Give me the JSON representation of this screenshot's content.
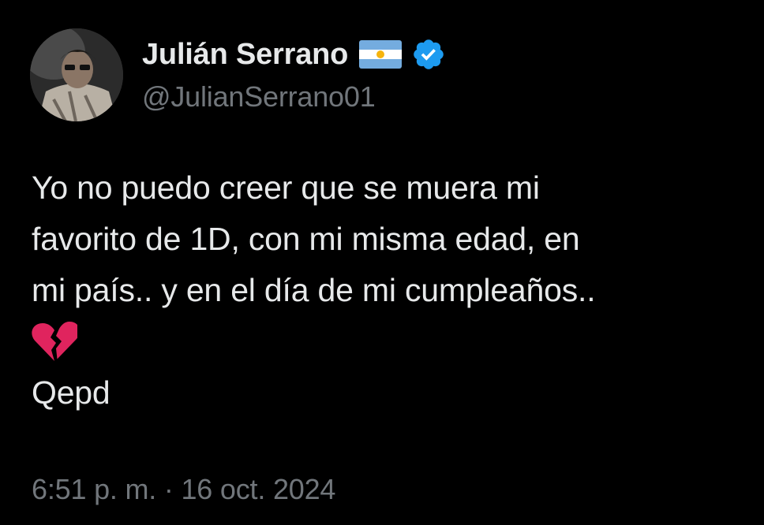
{
  "user": {
    "display_name": "Julián Serrano",
    "handle": "@JulianSerrano01",
    "flag_icon": "argentina-flag-icon",
    "verified_icon": "verified-badge-icon"
  },
  "tweet": {
    "lines": [
      "Yo no puedo creer que se muera mi",
      "favorito de 1D, con mi misma edad, en",
      "mi país.. y en el día de mi cumpleaños.."
    ],
    "emoji": "broken-heart-emoji",
    "closing": "Qepd"
  },
  "meta": {
    "timestamp": "6:51 p. m. · 16 oct. 2024"
  },
  "colors": {
    "background": "#000000",
    "text_primary": "#e7e9ea",
    "text_secondary": "#71767b",
    "verified_blue": "#1d9bf0",
    "heart_red": "#e0245e"
  }
}
